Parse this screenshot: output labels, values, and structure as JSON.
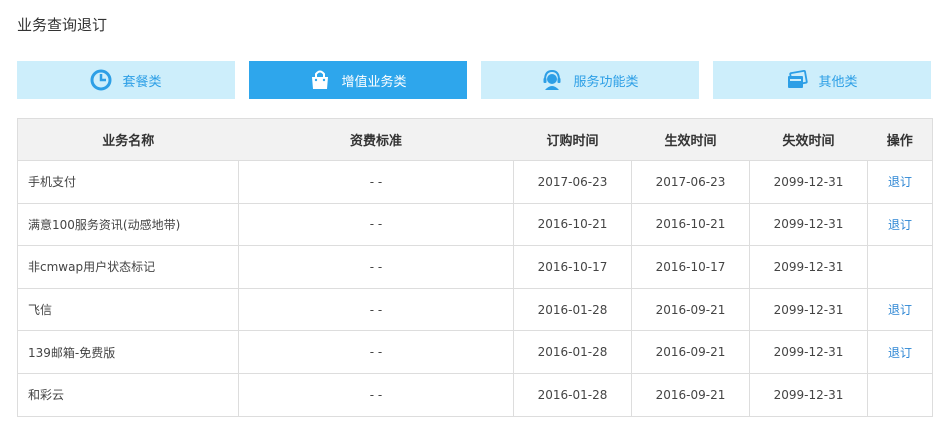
{
  "page": {
    "title": "业务查询退订"
  },
  "tabs": [
    {
      "label": "套餐类",
      "icon": "pie-chart-icon",
      "active": false
    },
    {
      "label": "增值业务类",
      "icon": "shopping-bag-icon",
      "active": true
    },
    {
      "label": "服务功能类",
      "icon": "customer-service-headset-icon",
      "active": false
    },
    {
      "label": "其他类",
      "icon": "cards-icon",
      "active": false
    }
  ],
  "colors": {
    "tab_bg": "#cdeefb",
    "tab_active_bg": "#2ea6ec",
    "tab_text": "#2d9fe6",
    "link": "#2d86d4",
    "header_bg": "#f2f2f2"
  },
  "table": {
    "headers": [
      "业务名称",
      "资费标准",
      "订购时间",
      "生效时间",
      "失效时间",
      "操作"
    ],
    "rows": [
      {
        "name": "手机支付",
        "fee": "- -",
        "order": "2017-06-23",
        "effective": "2017-06-23",
        "expire": "2099-12-31",
        "action": "退订"
      },
      {
        "name": "满意100服务资讯(动感地带)",
        "fee": "- -",
        "order": "2016-10-21",
        "effective": "2016-10-21",
        "expire": "2099-12-31",
        "action": "退订"
      },
      {
        "name": "非cmwap用户状态标记",
        "fee": "- -",
        "order": "2016-10-17",
        "effective": "2016-10-17",
        "expire": "2099-12-31",
        "action": ""
      },
      {
        "name": "飞信",
        "fee": "- -",
        "order": "2016-01-28",
        "effective": "2016-09-21",
        "expire": "2099-12-31",
        "action": "退订"
      },
      {
        "name": "139邮箱-免费版",
        "fee": "- -",
        "order": "2016-01-28",
        "effective": "2016-09-21",
        "expire": "2099-12-31",
        "action": "退订"
      },
      {
        "name": "和彩云",
        "fee": "- -",
        "order": "2016-01-28",
        "effective": "2016-09-21",
        "expire": "2099-12-31",
        "action": ""
      }
    ]
  }
}
